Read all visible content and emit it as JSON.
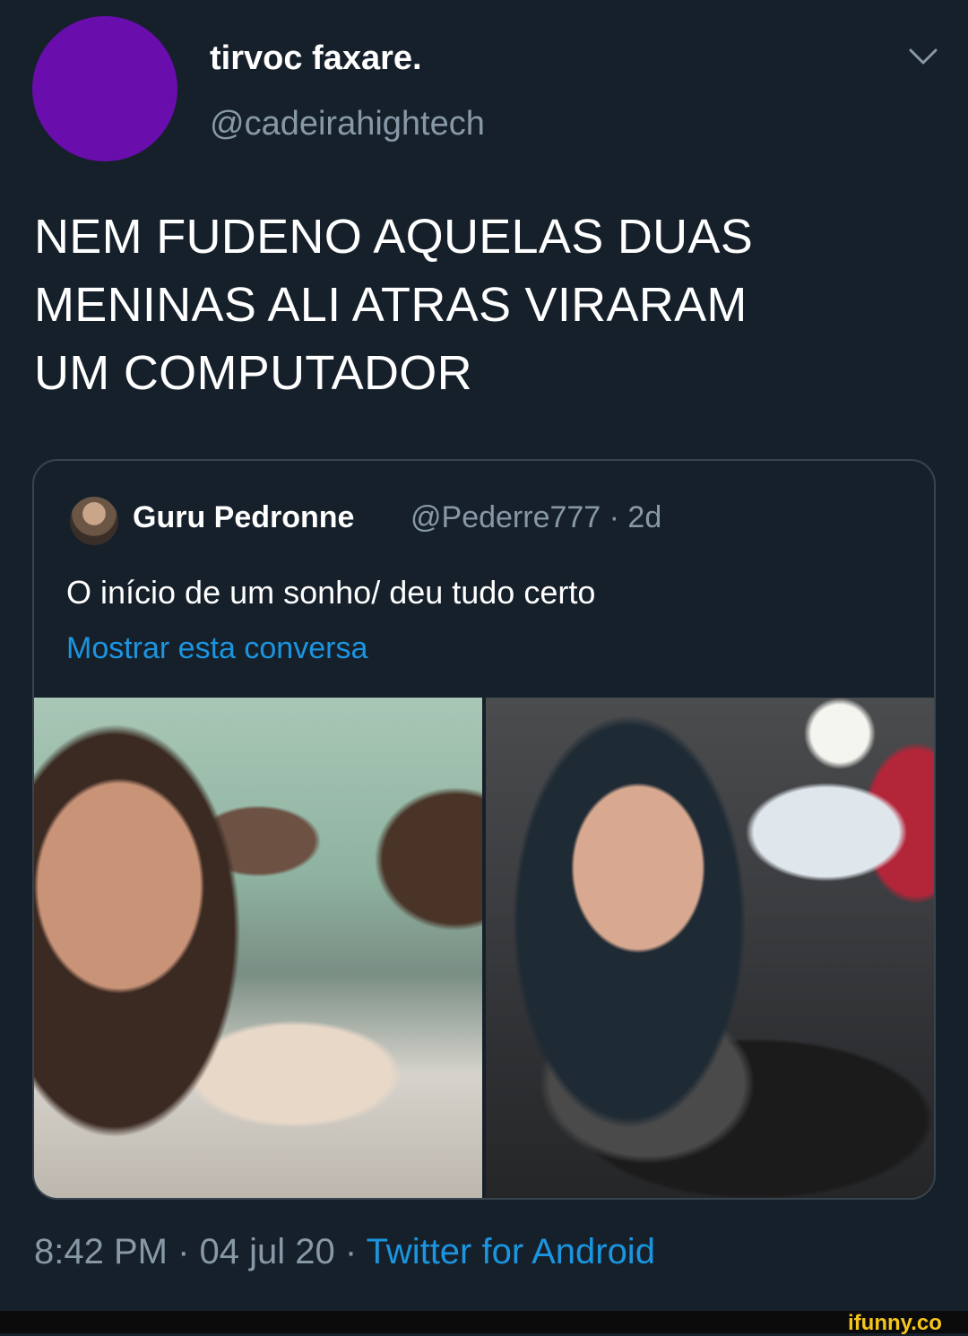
{
  "author": {
    "display_name": "tirvoc faxare.",
    "handle": "@cadeirahightech"
  },
  "tweet": {
    "text": "NEM FUDENO AQUELAS DUAS\nMENINAS ALI ATRAS VIRARAM\nUM COMPUTADOR"
  },
  "quoted": {
    "display_name": "Guru Pedronne",
    "handle_and_age": "@Pederre777 · 2d",
    "text": "O início de um sonho/ deu tudo certo",
    "show_thread": "Mostrar esta conversa"
  },
  "meta": {
    "time_date": "8:42 PM · 04 jul 20 · ",
    "source": "Twitter for Android"
  },
  "watermark": "ifunny.co",
  "colors": {
    "background": "#15202b",
    "secondary_text": "#8899a6",
    "link": "#1b95e0",
    "avatar": "#6a0dad",
    "watermark": "#f6c51c"
  },
  "icons": {
    "menu": "chevron-down-icon"
  }
}
